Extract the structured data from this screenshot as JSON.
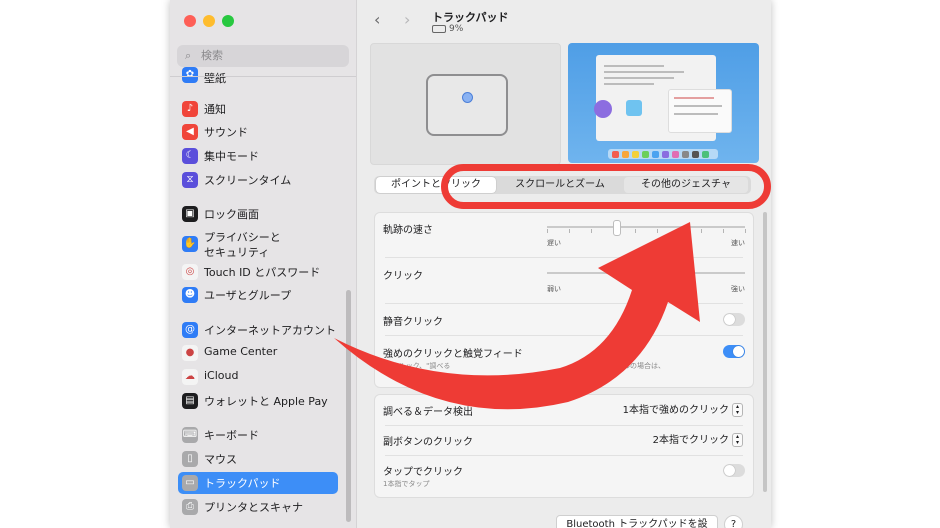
{
  "sidebar": {
    "search_placeholder": "検索",
    "partial_item": "壁紙",
    "items": [
      {
        "label": "通知",
        "color": "#f0453a",
        "icon": "bell-icon",
        "glyph": "♪"
      },
      {
        "label": "サウンド",
        "color": "#f0453a",
        "icon": "speaker-icon",
        "glyph": "◀"
      },
      {
        "label": "集中モード",
        "color": "#5b4fdb",
        "icon": "moon-icon",
        "glyph": "☾"
      },
      {
        "label": "スクリーンタイム",
        "color": "#5b4fdb",
        "icon": "hourglass-icon",
        "glyph": "⧖"
      },
      {
        "label": "ロック画面",
        "color": "#1d1d1f",
        "icon": "lock-icon",
        "glyph": "▣"
      },
      {
        "label": "プライバシーと",
        "label2": "セキュリティ",
        "color": "#2f7cf6",
        "icon": "hand-icon",
        "glyph": "✋"
      },
      {
        "label": "Touch ID とパスワード",
        "color": "#f4f4f4",
        "icon": "fingerprint-icon",
        "glyph": "◎"
      },
      {
        "label": "ユーザとグループ",
        "color": "#2f7cf6",
        "icon": "users-icon",
        "glyph": "☻"
      },
      {
        "label": "インターネットアカウント",
        "color": "#2f7cf6",
        "icon": "at-icon",
        "glyph": "@"
      },
      {
        "label": "Game Center",
        "color": "#f4f4f4",
        "icon": "game-center-icon",
        "glyph": "●"
      },
      {
        "label": "iCloud",
        "color": "#f4f4f4",
        "icon": "cloud-icon",
        "glyph": "☁"
      },
      {
        "label": "ウォレットと Apple Pay",
        "color": "#1d1d1f",
        "icon": "wallet-icon",
        "glyph": "▤"
      },
      {
        "label": "キーボード",
        "color": "#a9a9ab",
        "icon": "keyboard-icon",
        "glyph": "⌨"
      },
      {
        "label": "マウス",
        "color": "#a9a9ab",
        "icon": "mouse-icon",
        "glyph": "▯"
      },
      {
        "label": "トラックパッド",
        "color": "#a9a9ab",
        "icon": "trackpad-icon",
        "glyph": "▭"
      },
      {
        "label": "プリンタとスキャナ",
        "color": "#a9a9ab",
        "icon": "printer-icon",
        "glyph": "⎙"
      }
    ]
  },
  "content": {
    "title": "トラックパッド",
    "battery": "9%",
    "tabs": [
      "ポイントとクリック",
      "スクロールとズーム",
      "その他のジェスチャ"
    ],
    "tracking": {
      "label": "軌跡の速さ",
      "min": "遅い",
      "max": "速い",
      "value_fraction": 0.35
    },
    "click": {
      "label": "クリック",
      "min": "弱い",
      "max": "強い",
      "value_fraction": 0.5
    },
    "silent_click": {
      "label": "静音クリック",
      "on": false
    },
    "force_click": {
      "label": "強めのクリックと触覚フィード",
      "desc_left": "ックルック、\"調べる",
      "desc_right": "ントロールの場合は、",
      "on": true
    },
    "lookup": {
      "label": "調べる＆データ検出",
      "value": "1本指で強めのクリック"
    },
    "secondary": {
      "label": "副ボタンのクリック",
      "value": "2本指でクリック"
    },
    "tap": {
      "label": "タップでクリック",
      "sub": "1本指でタップ",
      "on": false
    },
    "bt_button": "Bluetooth トラックパッドを設定...",
    "help": "?"
  },
  "colors": {
    "accent": "#3d8ef7",
    "highlight": "#ee3b35"
  }
}
